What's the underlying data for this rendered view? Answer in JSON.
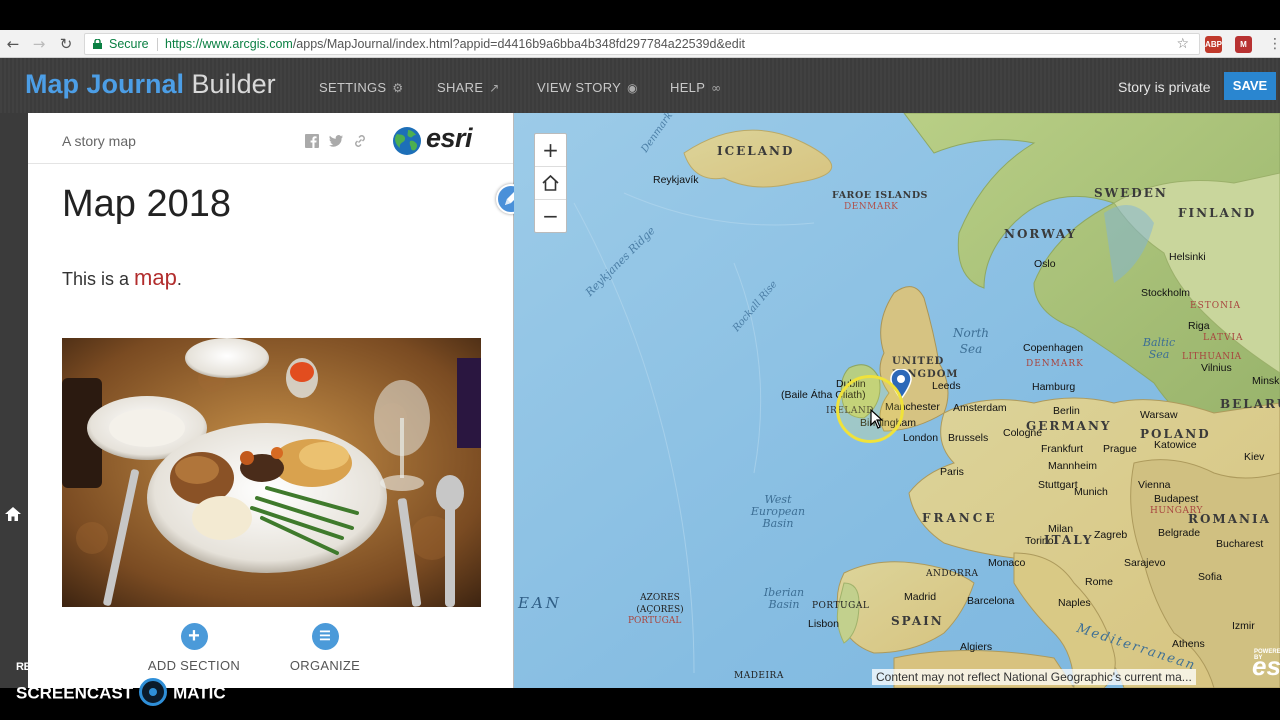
{
  "browser": {
    "secure_label": "Secure",
    "url_host": "https://www.arcgis.com",
    "url_path": "/apps/MapJournal/index.html?appid=d4416b9a6bba4b348fd297784a22539d&edit",
    "extensions": [
      {
        "name": "adblock-icon",
        "label": "ABP",
        "color": "#c0392b"
      },
      {
        "name": "extension-icon",
        "label": "M",
        "color": "#b83232"
      }
    ]
  },
  "header": {
    "brand_main": "Map Journal",
    "brand_sub": "Builder",
    "nav": [
      {
        "label": "SETTINGS",
        "icon": "gear-icon"
      },
      {
        "label": "SHARE",
        "icon": "share-icon"
      },
      {
        "label": "VIEW STORY",
        "icon": "eye-icon"
      },
      {
        "label": "HELP",
        "icon": "binoculars-icon"
      }
    ],
    "privacy": "Story is private",
    "save_label": "SAVE"
  },
  "panel": {
    "subtitle": "A story map",
    "logo_text": "esri",
    "title": "Map 2018",
    "body_prefix": "This is a ",
    "body_link": "map",
    "body_suffix": ".",
    "add_section_label": "ADD SECTION",
    "organize_label": "ORGANIZE"
  },
  "map": {
    "attribution": "Content may not reflect National Geographic's current ma...",
    "logo_text": "esri",
    "powered_label": "POWERED BY",
    "labels": {
      "iceland": "ICELAND",
      "reykjavik": "Reykjavík",
      "faroe": "FAROE ISLANDS",
      "denmark_sub": "DENMARK",
      "sweden": "SWEDEN",
      "finland": "FINLAND",
      "norway": "NORWAY",
      "oslo": "Oslo",
      "helsinki": "Helsinki",
      "stockholm": "Stockholm",
      "estonia": "ESTONIA",
      "riga": "Riga",
      "latvia": "LATVIA",
      "baltic": "Baltic Sea",
      "lithuania": "LITHUANIA",
      "vilnius": "Vilnius",
      "minsk": "Minsk",
      "belarus": "BELARUS",
      "north_sea": "North Sea",
      "copenhagen": "Copenhagen",
      "denmark": "DENMARK",
      "uk": "UNITED KINGDOM",
      "leeds": "Leeds",
      "manchester": "Manchester",
      "birmingham": "Birmingham",
      "london": "London",
      "dublin": "Dublin",
      "baile": "(Baile Átha Cliath)",
      "ireland": "IRELAND",
      "amsterdam": "Amsterdam",
      "brussels": "Brussels",
      "hamburg": "Hamburg",
      "berlin": "Berlin",
      "warsaw": "Warsaw",
      "poland": "POLAND",
      "germany": "GERMANY",
      "cologne": "Cologne",
      "frankfurt": "Frankfurt",
      "prague": "Prague",
      "katowice": "Katowice",
      "kiev": "Kiev",
      "paris": "Paris",
      "mannheim": "Mannheim",
      "stuttgart": "Stuttgart",
      "munich": "Munich",
      "vienna": "Vienna",
      "budapest": "Budapest",
      "hungary": "HUNGARY",
      "romania": "ROMANIA",
      "france": "FRANCE",
      "milan": "Milan",
      "zagreb": "Zagreb",
      "bucharest": "Bucharest",
      "torino": "Torino",
      "italy": "ITALY",
      "belgrade": "Belgrade",
      "sarajevo": "Sarajevo",
      "monaco": "Monaco",
      "andorra": "ANDORRA",
      "rome": "Rome",
      "sofia": "Sofia",
      "madrid": "Madrid",
      "barcelona": "Barcelona",
      "naples": "Naples",
      "spain": "SPAIN",
      "portugal": "PORTUGAL",
      "lisbon": "Lisbon",
      "algiers": "Algiers",
      "athens": "Athens",
      "izmir": "Izmir",
      "azores": "AZORES (AÇORES)",
      "azores_pt": "PORTUGAL",
      "west_basin": "West European Basin",
      "iberian": "Iberian Basin",
      "madeira": "MADEIRA",
      "ocean": "EAN",
      "mediterranean": "Mediterranean",
      "rockall": "Rockall Rise",
      "reykjanes": "Reykjanes Ridge",
      "denmark_strait": "Denmark"
    }
  },
  "recording": {
    "recorded_with": "RECORDED WITH",
    "brand_left": "SCREENCAST",
    "brand_right": "MATIC"
  },
  "colors": {
    "accent": "#2a86d0",
    "brand_blue": "#4c9ee6",
    "header_bg": "#3d3d3d",
    "highlight_red": "#b22d2d",
    "ocean": "#8fc2e4",
    "land": "#e3d18f"
  }
}
